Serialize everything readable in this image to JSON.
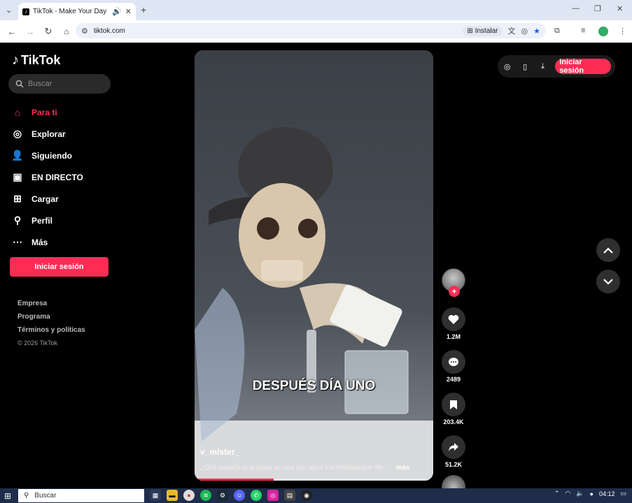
{
  "browser": {
    "tab_title": "TikTok - Make Your Day",
    "url": "tiktok.com",
    "install_label": "Instalar",
    "new_tab_glyph": "+",
    "close_glyph": "✕"
  },
  "sidebar": {
    "logo": "TikTok",
    "search_placeholder": "Buscar",
    "items": [
      {
        "label": "Para ti",
        "icon": "home-icon",
        "active": true
      },
      {
        "label": "Explorar",
        "icon": "compass-icon"
      },
      {
        "label": "Siguiendo",
        "icon": "following-icon"
      },
      {
        "label": "EN DIRECTO",
        "icon": "live-tv-icon"
      },
      {
        "label": "Cargar",
        "icon": "upload-icon"
      },
      {
        "label": "Perfil",
        "icon": "profile-icon"
      },
      {
        "label": "Más",
        "icon": "more-icon"
      }
    ],
    "login_label": "Iniciar sesión",
    "footer": [
      "Empresa",
      "Programa",
      "Términos y políticas"
    ],
    "copyright": "© 2026 TikTok"
  },
  "video": {
    "caption": "DESPUÉS DÍA UNO",
    "username": "v_mister_",
    "description": "¿Qué pasaría si te lavas la cara con agua fría?#sabiasque #ty ...",
    "more_label": "más",
    "progress": 0.33
  },
  "actions": {
    "likes": "1.2M",
    "comments": "2489",
    "saves": "203.4K",
    "shares": "51.2K"
  },
  "topbar": {
    "login_label": "Iniciar sesión"
  },
  "taskbar": {
    "search_placeholder": "Buscar",
    "time": "04:12"
  },
  "colors": {
    "accent": "#fe2c55",
    "background": "#000000"
  }
}
